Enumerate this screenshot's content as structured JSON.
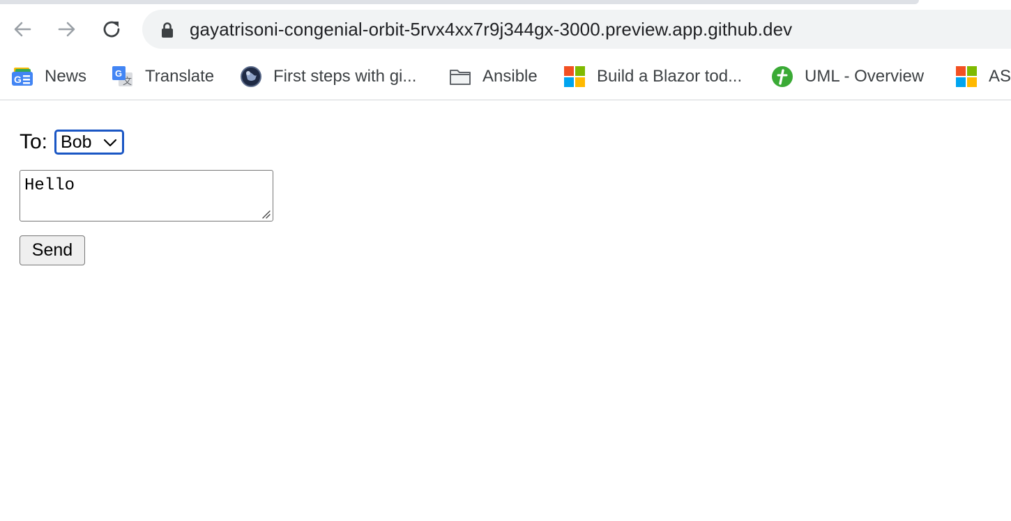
{
  "browser": {
    "url": "gayatrisoni-congenial-orbit-5rvx4xx7r9j344gx-3000.preview.app.github.dev",
    "bookmarks": [
      {
        "label": "News",
        "icon": "google-news-icon"
      },
      {
        "label": "Translate",
        "icon": "google-translate-icon"
      },
      {
        "label": "First steps with gi...",
        "icon": "globe-icon"
      },
      {
        "label": "Ansible",
        "icon": "folder-icon"
      },
      {
        "label": "Build a Blazor tod...",
        "icon": "microsoft-logo-icon"
      },
      {
        "label": "UML - Overview",
        "icon": "green-circle-logo-icon"
      },
      {
        "label": "AS",
        "icon": "microsoft-logo-icon"
      }
    ]
  },
  "form": {
    "to_label": "To:",
    "recipient": "Bob",
    "message": "Hello",
    "send_label": "Send"
  },
  "colors": {
    "focus_ring": "#1a56c4",
    "omnibox_bg": "#f1f3f4",
    "button_bg": "#efefef"
  }
}
